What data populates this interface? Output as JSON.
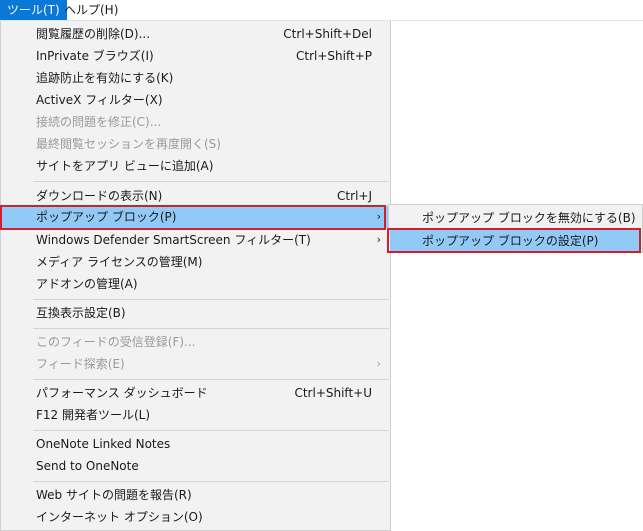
{
  "menubar": {
    "tools_label": "ツール(T)",
    "help_label": "ヘルプ(H)"
  },
  "tools_menu": {
    "items": [
      {
        "label": "閲覧履歴の削除(D)...",
        "shortcut": "Ctrl+Shift+Del"
      },
      {
        "label": "InPrivate ブラウズ(I)",
        "shortcut": "Ctrl+Shift+P"
      },
      {
        "label": "追跡防止を有効にする(K)",
        "shortcut": ""
      },
      {
        "label": "ActiveX フィルター(X)",
        "shortcut": ""
      },
      {
        "label": "接続の問題を修正(C)...",
        "shortcut": "",
        "disabled": true
      },
      {
        "label": "最終閲覧セッションを再度開く(S)",
        "shortcut": "",
        "disabled": true
      },
      {
        "label": "サイトをアプリ ビューに追加(A)",
        "shortcut": ""
      },
      {
        "label": "ダウンロードの表示(N)",
        "shortcut": "Ctrl+J"
      },
      {
        "label": "ポップアップ ブロック(P)",
        "shortcut": "",
        "submenu": true,
        "highlighted": true
      },
      {
        "label": "Windows Defender SmartScreen フィルター(T)",
        "shortcut": "",
        "submenu": true
      },
      {
        "label": "メディア ライセンスの管理(M)",
        "shortcut": ""
      },
      {
        "label": "アドオンの管理(A)",
        "shortcut": ""
      },
      {
        "label": "互換表示設定(B)",
        "shortcut": ""
      },
      {
        "label": "このフィードの受信登録(F)...",
        "shortcut": "",
        "disabled": true
      },
      {
        "label": "フィード探索(E)",
        "shortcut": "",
        "disabled": true,
        "submenu": true
      },
      {
        "label": "パフォーマンス ダッシュボード",
        "shortcut": "Ctrl+Shift+U"
      },
      {
        "label": "F12 開発者ツール(L)",
        "shortcut": ""
      },
      {
        "label": "OneNote Linked Notes",
        "shortcut": ""
      },
      {
        "label": "Send to OneNote",
        "shortcut": ""
      },
      {
        "label": "Web サイトの問題を報告(R)",
        "shortcut": ""
      },
      {
        "label": "インターネット オプション(O)",
        "shortcut": ""
      }
    ]
  },
  "popup_submenu": {
    "items": [
      {
        "label": "ポップアップ ブロックを無効にする(B)"
      },
      {
        "label": "ポップアップ ブロックの設定(P)",
        "highlighted": true
      }
    ]
  },
  "submenu_arrow_glyph": "›",
  "colors": {
    "menu_bg": "#f2f2f2",
    "highlight": "#91c9f7",
    "active_menu": "#0a78d7",
    "annotation_red": "#d0202e",
    "disabled_text": "#9a9a9a"
  }
}
